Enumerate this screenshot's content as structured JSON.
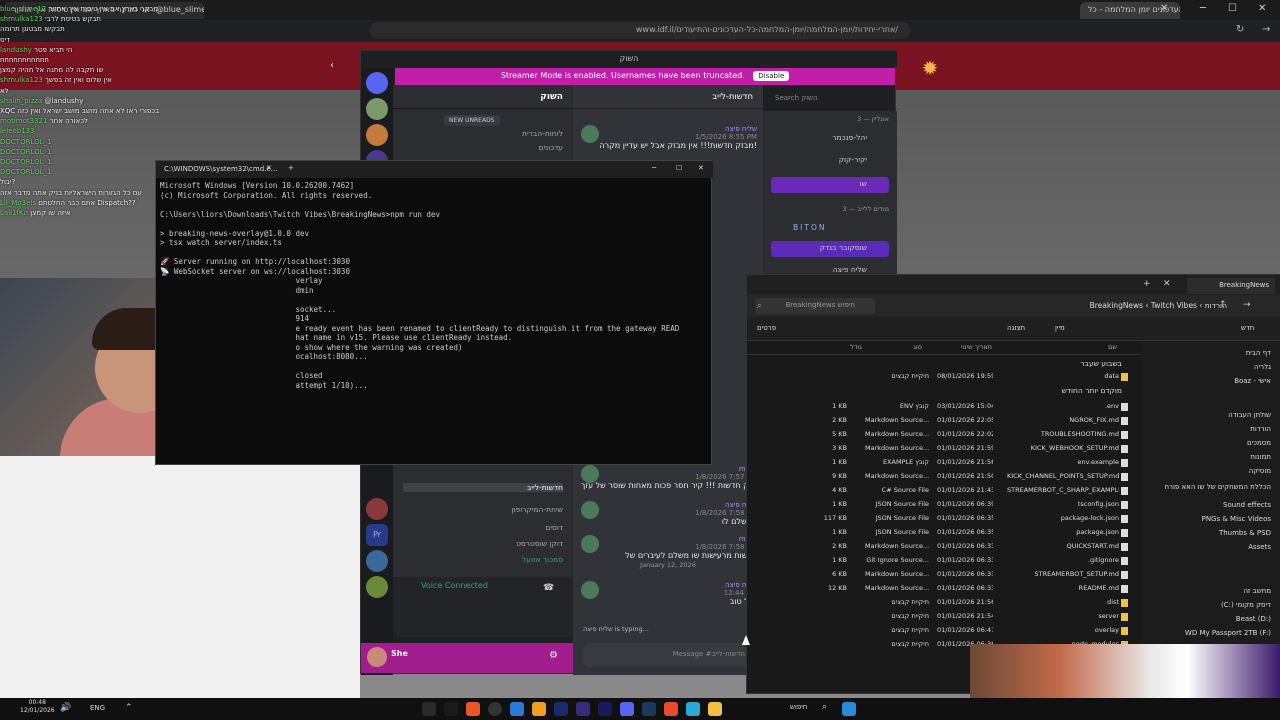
{
  "browser": {
    "tabs": [
      "אני מבקר בארץ אם אין טיסות איך אחזור :@blue_slime12",
      "כל העדכונים יומן המלחמה - כל ..."
    ],
    "url": "www.idf.il/אתרי-יחידות/יומן-המלחמה/יומן-המלחמה-כל-העדכונים-והתיעודים/"
  },
  "chat": {
    "lines": [
      {
        "name": "blue_slime12",
        "text": "אני מבקר בארץ אם אין טיסות איך אחזור"
      },
      {
        "name": "shmulka123",
        "text": "תבקש בטיסת לרבי"
      },
      {
        "name": "",
        "text": "תבקשו מבטוגן תרומה"
      },
      {
        "name": "",
        "text": "דיס"
      },
      {
        "name": "landushy",
        "text": "הי תביא פטר"
      },
      {
        "name": "",
        "text": "nnnnnnnnnnn"
      },
      {
        "name": "",
        "text": "שו תקבה לה מתנה אל תהיה קמצן"
      },
      {
        "name": "shmulka123",
        "text": "אין שלום ואין זה בפשך"
      },
      {
        "name": "",
        "text": "לא"
      },
      {
        "name": "shalih_pizza",
        "text": "@landushy"
      },
      {
        "name": "",
        "text": "XQC בכפורי ראו לא אתה מושב מושב ישראל ואין כזה MCSR RANKED 22:18"
      },
      {
        "name": "motimot3321",
        "text": "לכאורה אחר"
      },
      {
        "name": "leleob133",
        "text": ""
      },
      {
        "name": "DOCTORLOL_1",
        "text": ""
      },
      {
        "name": "DOCTORLOL_1",
        "text": ""
      },
      {
        "name": "DOCTORLOL_1",
        "text": ""
      },
      {
        "name": "DOCTORLOL_1",
        "text": ""
      },
      {
        "name": "",
        "text": "יבול?"
      },
      {
        "name": "",
        "text": "עם כל הגזורות הישראליות בניק אתה מדבר אזה"
      },
      {
        "name": "Lil_Mo3els",
        "text": "אתם כבר החלטתם Dispatch??"
      },
      {
        "name": "Lali1fKn",
        "text": "איזה שו קמצן"
      }
    ]
  },
  "discord": {
    "window_title": "השוק",
    "streamer_banner": "Streamer Mode is enabled. Usernames have been truncated.",
    "disable_label": "Disable",
    "server_name": "השוק",
    "new_unreads": "NEW UNREADS",
    "channels": [
      "עדכוני ...",
      "לוחות-הברית",
      "עדכונים",
      "חדשות-לייב",
      "שיחת-המיקרופון",
      "דוסים",
      "דוקן שוסטרסט",
      "סמכוך אזועל"
    ],
    "voice_status": "Voice Connected",
    "user_name": "She",
    "channel_header": "חדשות-לייב",
    "search_placeholder": "Search השוק",
    "messages": [
      {
        "name": "שליח פיצה",
        "time": "1/5/2026 8:55 PM",
        "text": "מבזק חדשות!!! אין מבזק אבל יש עדיין מקרה!"
      },
      {
        "name": "mpro",
        "time": "1/8/2026 7:57 PM",
        "text": "מבזק חדשות !!! קיר חסר פכות מאחות שוסר של עזך??"
      },
      {
        "name": "שליח פיצה",
        "time": "1/8/2026 7:58 PM",
        "text": "שו שלם לו"
      },
      {
        "name": "mpro",
        "time": "1/8/2026 7:58 PM",
        "text": "חדשות מרעישות שו משלם לעיברים של"
      },
      {
        "name": "שליח פיצה",
        "time": "12:44 AM",
        "text": "מזל טוב"
      }
    ],
    "date_divider": "January 12, 2026",
    "typing": "שליח פיצה is typing...",
    "message_placeholder": "Message #חדשות-לייב",
    "members_online_header": "אונליין — 3",
    "members": [
      "יהל-סנכמר",
      "יקיר-קוק",
      "שו",
      "BITON",
      "שוסקובר בנדק",
      "שליח פיצה"
    ],
    "members_offline_header": "מודים ללייב — 3"
  },
  "cmd": {
    "title": "C:\\WINDOWS\\system32\\cmd.e...",
    "lines": [
      "Microsoft Windows [Version 10.0.26200.7462]",
      "(c) Microsoft Corporation. All rights reserved.",
      "",
      "C:\\Users\\liors\\Downloads\\Twitch Vibes\\BreakingNews>npm run dev",
      "",
      "> breaking-news-overlay@1.0.0 dev",
      "> tsx watch server/index.ts",
      "",
      "🚀 Server running on http://localhost:3030",
      "📡 WebSocket server on ws://localhost:3030",
      "                              verlay",
      "                              dmin",
      "",
      "                              socket...",
      "                              914",
      "                              e ready event has been renamed to clientReady to distinguish it from the gateway READ",
      "                              hat name in v15. Please use clientReady instead.",
      "                              o show where the warning was created)",
      "                              ocalhost:8080...",
      "",
      "                              closed",
      "                              attempt 1/10)..."
    ]
  },
  "explorer": {
    "tab_title": "BreakingNews",
    "path": [
      "הורדות",
      "Twitch Vibes",
      "BreakingNews"
    ],
    "search_placeholder": "BreakingNews חיפוש",
    "toolbar": {
      "new": "חדש",
      "sort": "מיין",
      "view": "תצוגה",
      "details": "פרטים"
    },
    "headers": [
      "שם",
      "תאריך שינוי",
      "סוג",
      "גודל"
    ],
    "groups": [
      "בשבוע שעבר",
      "מוקדם יותר החודש"
    ],
    "files": [
      {
        "name": "data",
        "date": "08/01/2026 19:59",
        "type": "תיקיית קבצים",
        "size": ""
      },
      {
        "name": ".env",
        "date": "03/01/2026 15:04",
        "type": "ENV קובץ",
        "size": "1 KB"
      },
      {
        "name": "NGROK_FIX.md",
        "date": "01/01/2026 22:05",
        "type": "Markdown Source...",
        "size": "2 KB"
      },
      {
        "name": "TROUBLESHOOTING.md",
        "date": "01/01/2026 22:02",
        "type": "Markdown Source...",
        "size": "5 KB"
      },
      {
        "name": "KICK_WEBHOOK_SETUP.md",
        "date": "01/01/2026 21:59",
        "type": "Markdown Source...",
        "size": "3 KB"
      },
      {
        "name": "env.example",
        "date": "01/01/2026 21:56",
        "type": "EXAMPLE קובץ",
        "size": "1 KB"
      },
      {
        "name": "KICK_CHANNEL_POINTS_SETUP.md",
        "date": "01/01/2026 21:50",
        "type": "Markdown Source...",
        "size": "9 KB"
      },
      {
        "name": "STREAMERBOT_C_SHARP_EXAMPLE.cs",
        "date": "01/01/2026 21:43",
        "type": "C# Source File",
        "size": "4 KB"
      },
      {
        "name": "tsconfig.json",
        "date": "01/01/2026 06:39",
        "type": "JSON Source File",
        "size": "1 KB"
      },
      {
        "name": "package-lock.json",
        "date": "01/01/2026 06:35",
        "type": "JSON Source File",
        "size": "117 KB"
      },
      {
        "name": "package.json",
        "date": "01/01/2026 06:35",
        "type": "JSON Source File",
        "size": "1 KB"
      },
      {
        "name": "QUICKSTART.md",
        "date": "01/01/2026 06:33",
        "type": "Markdown Source...",
        "size": "2 KB"
      },
      {
        "name": ".gitignore",
        "date": "01/01/2026 06:33",
        "type": "Git Ignore Source...",
        "size": "1 KB"
      },
      {
        "name": "STREAMERBOT_SETUP.md",
        "date": "01/01/2026 06:33",
        "type": "Markdown Source...",
        "size": "6 KB"
      },
      {
        "name": "README.md",
        "date": "01/01/2026 06:33",
        "type": "Markdown Source...",
        "size": "12 KB"
      },
      {
        "name": "dist",
        "date": "01/01/2026 21:56",
        "type": "תיקיית קבצים",
        "size": ""
      },
      {
        "name": "server",
        "date": "01/01/2026 21:54",
        "type": "תיקיית קבצים",
        "size": ""
      },
      {
        "name": "overlay",
        "date": "01/01/2026 06:41",
        "type": "תיקיית קבצים",
        "size": ""
      },
      {
        "name": "node_modules",
        "date": "01/01/2026 06:36",
        "type": "תיקיית קבצים",
        "size": ""
      }
    ],
    "sidebar": [
      "דף הבית",
      "גלריה",
      "Boaz - אישי",
      "שולחן העבודה",
      "הורדות",
      "מסמכים",
      "תמונות",
      "מוסיקה",
      "הכללת המשחקים של שו האא פורח",
      "Sound effects",
      "PNGs & Misc Videos",
      "Thumbs & PSD",
      "Assets",
      "מחשב זה",
      "(C:) דיסק מקומי",
      "Beast (D:)",
      "WD My Passport 2TB (F:)",
      "WD M"
    ]
  },
  "taskbar": {
    "search": "חיפוש",
    "lang": "ENG",
    "time": "00:48",
    "date": "12/01/2026"
  },
  "colors": {
    "streamer_banner": "#c21fa8",
    "discord_bg": "#313338",
    "idf_red": "#7a1420",
    "folder": "#f0c040"
  }
}
